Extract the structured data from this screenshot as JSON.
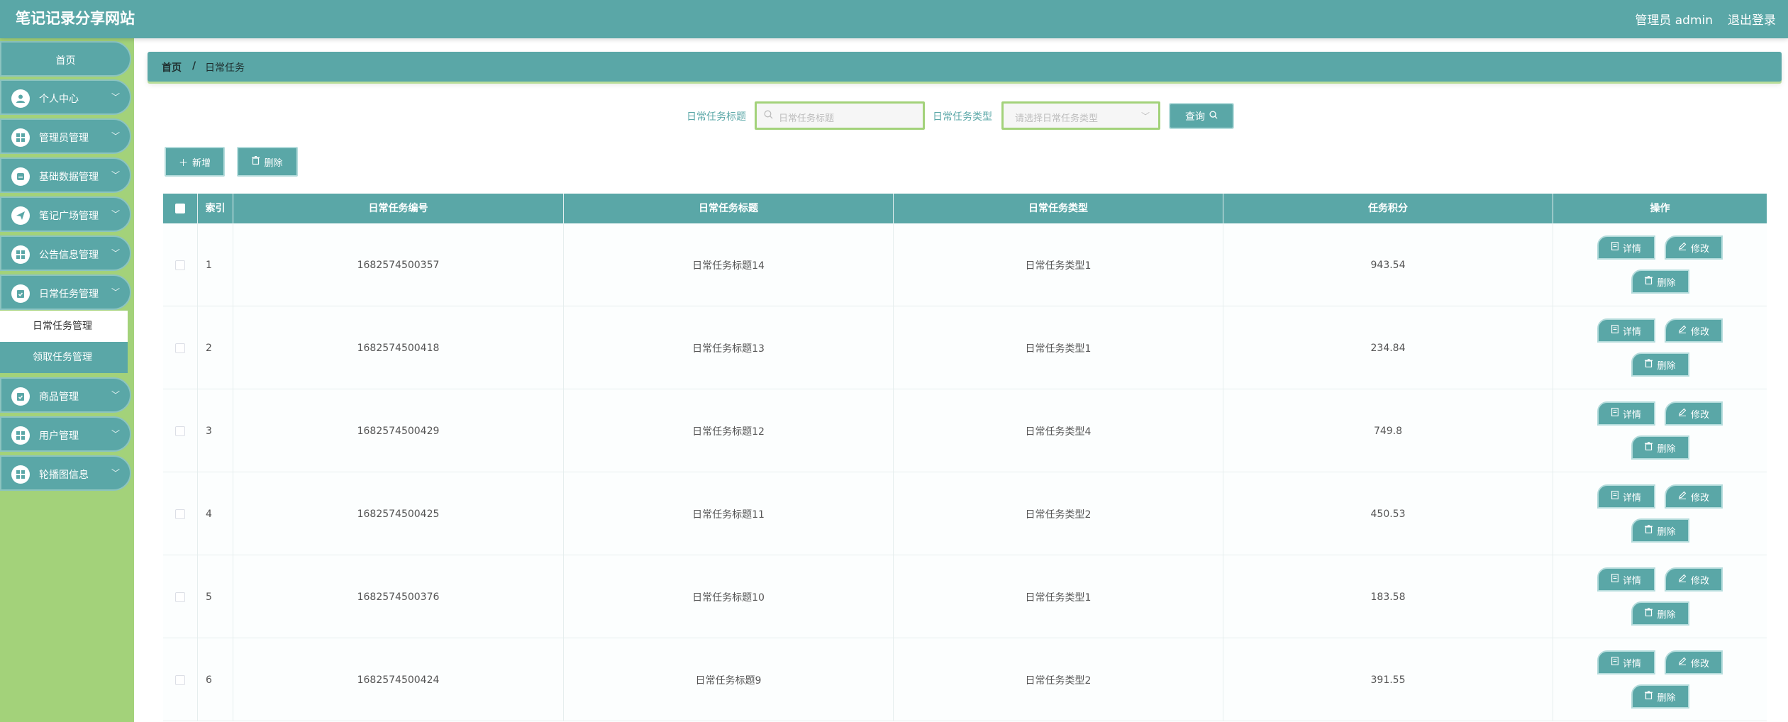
{
  "header": {
    "site_title": "笔记记录分享网站",
    "admin_text": "管理员 admin",
    "logout_label": "退出登录"
  },
  "sidebar": {
    "home": "首页",
    "items": [
      {
        "label": "个人中心",
        "icon": "person-icon"
      },
      {
        "label": "管理员管理",
        "icon": "grid-icon"
      },
      {
        "label": "基础数据管理",
        "icon": "database-icon"
      },
      {
        "label": "笔记广场管理",
        "icon": "send-icon"
      },
      {
        "label": "公告信息管理",
        "icon": "grid-icon"
      },
      {
        "label": "日常任务管理",
        "icon": "task-icon"
      },
      {
        "label": "商品管理",
        "icon": "task-icon"
      },
      {
        "label": "用户管理",
        "icon": "grid-icon"
      },
      {
        "label": "轮播图信息",
        "icon": "grid-icon"
      }
    ],
    "sub_items": [
      {
        "label": "日常任务管理",
        "active": true
      },
      {
        "label": "领取任务管理",
        "active": false
      }
    ]
  },
  "breadcrumb": {
    "home": "首页",
    "separator": "/",
    "current": "日常任务"
  },
  "search": {
    "title_label": "日常任务标题",
    "title_placeholder": "日常任务标题",
    "type_label": "日常任务类型",
    "type_placeholder": "请选择日常任务类型",
    "query_label": "查询"
  },
  "actions": {
    "add_label": "新增",
    "delete_label": "删除"
  },
  "table": {
    "headers": [
      "索引",
      "日常任务编号",
      "日常任务标题",
      "日常任务类型",
      "任务积分",
      "操作"
    ],
    "rows": [
      {
        "index": "1",
        "code": "1682574500357",
        "title": "日常任务标题14",
        "type": "日常任务类型1",
        "points": "943.54"
      },
      {
        "index": "2",
        "code": "1682574500418",
        "title": "日常任务标题13",
        "type": "日常任务类型1",
        "points": "234.84"
      },
      {
        "index": "3",
        "code": "1682574500429",
        "title": "日常任务标题12",
        "type": "日常任务类型4",
        "points": "749.8"
      },
      {
        "index": "4",
        "code": "1682574500425",
        "title": "日常任务标题11",
        "type": "日常任务类型2",
        "points": "450.53"
      },
      {
        "index": "5",
        "code": "1682574500376",
        "title": "日常任务标题10",
        "type": "日常任务类型1",
        "points": "183.58"
      },
      {
        "index": "6",
        "code": "1682574500424",
        "title": "日常任务标题9",
        "type": "日常任务类型2",
        "points": "391.55"
      }
    ],
    "op_labels": {
      "detail": "详情",
      "edit": "修改",
      "delete": "删除"
    }
  },
  "colors": {
    "primary": "#5aa7a7",
    "sidebar_bg": "#a3d27a",
    "accent_border": "#a3d27a"
  }
}
